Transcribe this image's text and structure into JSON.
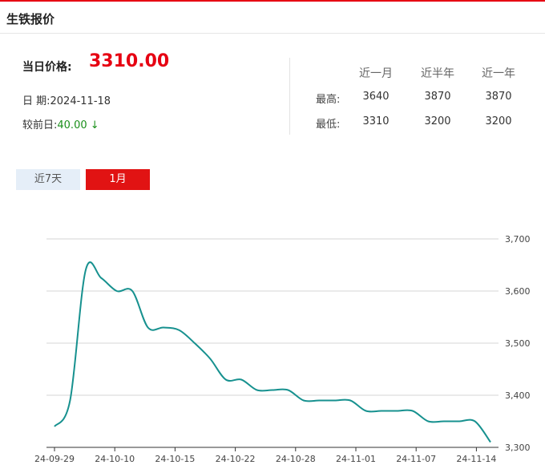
{
  "header": {
    "title": "生铁报价"
  },
  "summary": {
    "price_label": "当日价格:",
    "price_value": "3310.00",
    "date_label": "日 期:",
    "date_value": "2024-11-18",
    "change_label": "较前日:",
    "change_value": "40.00 ↓"
  },
  "stats": {
    "headers": [
      "近一月",
      "近半年",
      "近一年"
    ],
    "rows": [
      {
        "label": "最高:",
        "values": [
          "3640",
          "3870",
          "3870"
        ]
      },
      {
        "label": "最低:",
        "values": [
          "3310",
          "3200",
          "3200"
        ]
      }
    ]
  },
  "tabs": [
    {
      "label": "近7天",
      "active": false
    },
    {
      "label": "1月",
      "active": true
    }
  ],
  "colors": {
    "accent": "#e60012",
    "down": "#1a8f1a",
    "line": "#17918f",
    "tab_active": "#e11313",
    "tab_inactive": "#e5eef8"
  },
  "chart_data": {
    "type": "line",
    "x_ticks": [
      "24-09-29",
      "24-10-10",
      "24-10-15",
      "24-10-22",
      "24-10-28",
      "24-11-01",
      "24-11-07",
      "24-11-14"
    ],
    "y_ticks": [
      "3,700",
      "3,600",
      "3,500",
      "3,400",
      "3,300"
    ],
    "ylim": [
      3300,
      3700
    ],
    "grid": true,
    "series": [
      {
        "values": [
          3340,
          3390,
          3640,
          3625,
          3600,
          3600,
          3530,
          3530,
          3525,
          3500,
          3470,
          3430,
          3430,
          3410,
          3410,
          3410,
          3390,
          3390,
          3390,
          3390,
          3370,
          3370,
          3370,
          3370,
          3350,
          3350,
          3350,
          3350,
          3310
        ]
      }
    ]
  }
}
